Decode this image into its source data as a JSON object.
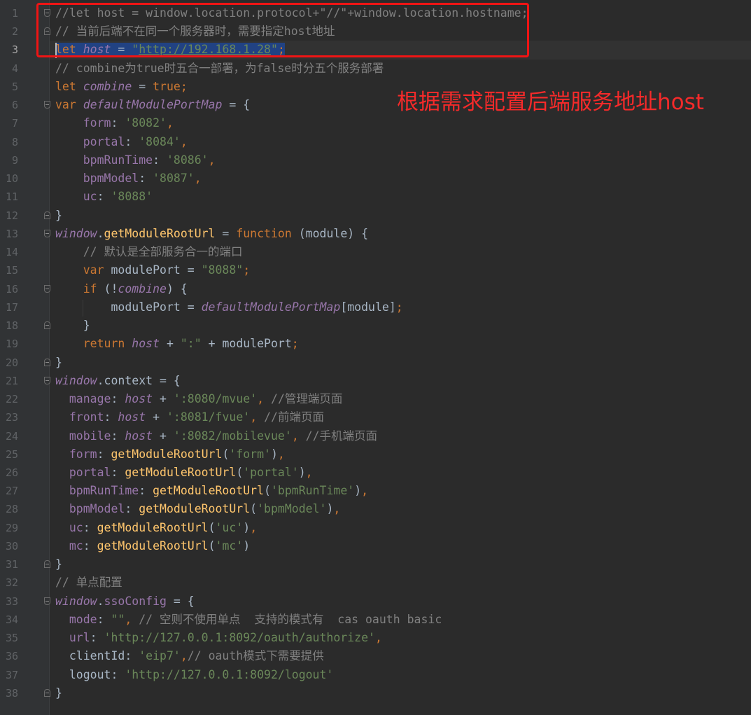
{
  "editor": {
    "current_line": 3,
    "colors": {
      "background": "#2b2b2b",
      "keyword": "#cc7832",
      "identifier": "#9876aa",
      "string": "#6a8759",
      "comment": "#808080",
      "function": "#ffc66d",
      "text": "#a9b7c6",
      "selection": "#214283"
    },
    "lines": [
      {
        "n": "1",
        "fold": "open",
        "tokens": [
          [
            "c",
            "//let host = window.location.protocol+\"//\"+window.location.hostname;"
          ]
        ]
      },
      {
        "n": "2",
        "fold": "close",
        "tokens": [
          [
            "c",
            "// 当前后端不在同一个服务器时，需要指定host地址"
          ]
        ]
      },
      {
        "n": "3",
        "selected": true,
        "tokens": [
          [
            "k",
            "let"
          ],
          [
            "t",
            " "
          ],
          [
            "v",
            "host"
          ],
          [
            "t",
            " = "
          ],
          [
            "s",
            "\""
          ],
          [
            "u",
            "http://192.168.1.28"
          ],
          [
            "s",
            "\""
          ],
          [
            "k",
            ";"
          ]
        ]
      },
      {
        "n": "4",
        "tokens": [
          [
            "c",
            "// combine为true时五合一部署，为false时分五个服务部署"
          ]
        ]
      },
      {
        "n": "5",
        "tokens": [
          [
            "k",
            "let "
          ],
          [
            "v",
            "combine"
          ],
          [
            "t",
            " = "
          ],
          [
            "k",
            "true;"
          ]
        ]
      },
      {
        "n": "6",
        "fold": "open",
        "tokens": [
          [
            "k",
            "var "
          ],
          [
            "v",
            "defaultModulePortMap"
          ],
          [
            "t",
            " = {"
          ]
        ]
      },
      {
        "n": "7",
        "tokens": [
          [
            "p",
            "    form"
          ],
          [
            "t",
            ": "
          ],
          [
            "s",
            "'8082'"
          ],
          [
            "k",
            ","
          ]
        ]
      },
      {
        "n": "8",
        "tokens": [
          [
            "p",
            "    portal"
          ],
          [
            "t",
            ": "
          ],
          [
            "s",
            "'8084'"
          ],
          [
            "k",
            ","
          ]
        ]
      },
      {
        "n": "9",
        "tokens": [
          [
            "p",
            "    bpmRunTime"
          ],
          [
            "t",
            ": "
          ],
          [
            "s",
            "'8086'"
          ],
          [
            "k",
            ","
          ]
        ]
      },
      {
        "n": "10",
        "tokens": [
          [
            "p",
            "    bpmModel"
          ],
          [
            "t",
            ": "
          ],
          [
            "s",
            "'8087'"
          ],
          [
            "k",
            ","
          ]
        ]
      },
      {
        "n": "11",
        "tokens": [
          [
            "p",
            "    uc"
          ],
          [
            "t",
            ": "
          ],
          [
            "s",
            "'8088'"
          ]
        ]
      },
      {
        "n": "12",
        "fold": "close",
        "tokens": [
          [
            "t",
            "}"
          ]
        ]
      },
      {
        "n": "13",
        "fold": "open",
        "tokens": [
          [
            "v",
            "window"
          ],
          [
            "t",
            "."
          ],
          [
            "f",
            "getModuleRootUrl"
          ],
          [
            "t",
            " = "
          ],
          [
            "k",
            "function"
          ],
          [
            "t",
            " (module) {"
          ]
        ]
      },
      {
        "n": "14",
        "tokens": [
          [
            "c",
            "    // 默认是全部服务合一的端口"
          ]
        ]
      },
      {
        "n": "15",
        "tokens": [
          [
            "k",
            "    var"
          ],
          [
            "t",
            " modulePort = "
          ],
          [
            "s",
            "\"8088\""
          ],
          [
            "k",
            ";"
          ]
        ]
      },
      {
        "n": "16",
        "fold": "open",
        "tokens": [
          [
            "k",
            "    if"
          ],
          [
            "t",
            " (!"
          ],
          [
            "v",
            "combine"
          ],
          [
            "t",
            ") {"
          ]
        ]
      },
      {
        "n": "17",
        "tokens": [
          [
            "t",
            "        modulePort = "
          ],
          [
            "v",
            "defaultModulePortMap"
          ],
          [
            "t",
            "[module]"
          ],
          [
            "k",
            ";"
          ]
        ]
      },
      {
        "n": "18",
        "fold": "close",
        "tokens": [
          [
            "t",
            "    }"
          ]
        ]
      },
      {
        "n": "19",
        "tokens": [
          [
            "k",
            "    return "
          ],
          [
            "v",
            "host"
          ],
          [
            "t",
            " + "
          ],
          [
            "s",
            "\":\""
          ],
          [
            "t",
            " + modulePort"
          ],
          [
            "k",
            ";"
          ]
        ]
      },
      {
        "n": "20",
        "fold": "close",
        "tokens": [
          [
            "t",
            "}"
          ]
        ]
      },
      {
        "n": "21",
        "fold": "open",
        "tokens": [
          [
            "v",
            "window"
          ],
          [
            "t",
            ".context = {"
          ]
        ]
      },
      {
        "n": "22",
        "tokens": [
          [
            "p",
            "  manage"
          ],
          [
            "t",
            ": "
          ],
          [
            "v",
            "host"
          ],
          [
            "t",
            " + "
          ],
          [
            "s",
            "':8080/mvue'"
          ],
          [
            "k",
            ","
          ],
          [
            "c",
            " //管理端页面"
          ]
        ]
      },
      {
        "n": "23",
        "tokens": [
          [
            "p",
            "  front"
          ],
          [
            "t",
            ": "
          ],
          [
            "v",
            "host"
          ],
          [
            "t",
            " + "
          ],
          [
            "s",
            "':8081/fvue'"
          ],
          [
            "k",
            ","
          ],
          [
            "c",
            " //前端页面"
          ]
        ]
      },
      {
        "n": "24",
        "tokens": [
          [
            "p",
            "  mobile"
          ],
          [
            "t",
            ": "
          ],
          [
            "v",
            "host"
          ],
          [
            "t",
            " + "
          ],
          [
            "s",
            "':8082/mobilevue'"
          ],
          [
            "k",
            ","
          ],
          [
            "c",
            " //手机端页面"
          ]
        ]
      },
      {
        "n": "25",
        "tokens": [
          [
            "p",
            "  form"
          ],
          [
            "t",
            ": "
          ],
          [
            "f",
            "getModuleRootUrl"
          ],
          [
            "t",
            "("
          ],
          [
            "s",
            "'form'"
          ],
          [
            "t",
            ")"
          ],
          [
            "k",
            ","
          ]
        ]
      },
      {
        "n": "26",
        "tokens": [
          [
            "p",
            "  portal"
          ],
          [
            "t",
            ": "
          ],
          [
            "f",
            "getModuleRootUrl"
          ],
          [
            "t",
            "("
          ],
          [
            "s",
            "'portal'"
          ],
          [
            "t",
            ")"
          ],
          [
            "k",
            ","
          ]
        ]
      },
      {
        "n": "27",
        "tokens": [
          [
            "p",
            "  bpmRunTime"
          ],
          [
            "t",
            ": "
          ],
          [
            "f",
            "getModuleRootUrl"
          ],
          [
            "t",
            "("
          ],
          [
            "s",
            "'bpmRunTime'"
          ],
          [
            "t",
            ")"
          ],
          [
            "k",
            ","
          ]
        ]
      },
      {
        "n": "28",
        "tokens": [
          [
            "p",
            "  bpmModel"
          ],
          [
            "t",
            ": "
          ],
          [
            "f",
            "getModuleRootUrl"
          ],
          [
            "t",
            "("
          ],
          [
            "s",
            "'bpmModel'"
          ],
          [
            "t",
            ")"
          ],
          [
            "k",
            ","
          ]
        ]
      },
      {
        "n": "29",
        "tokens": [
          [
            "p",
            "  uc"
          ],
          [
            "t",
            ": "
          ],
          [
            "f",
            "getModuleRootUrl"
          ],
          [
            "t",
            "("
          ],
          [
            "s",
            "'uc'"
          ],
          [
            "t",
            ")"
          ],
          [
            "k",
            ","
          ]
        ]
      },
      {
        "n": "30",
        "tokens": [
          [
            "p",
            "  mc"
          ],
          [
            "t",
            ": "
          ],
          [
            "f",
            "getModuleRootUrl"
          ],
          [
            "t",
            "("
          ],
          [
            "s",
            "'mc'"
          ],
          [
            "t",
            ")"
          ]
        ]
      },
      {
        "n": "31",
        "fold": "close",
        "tokens": [
          [
            "t",
            "}"
          ]
        ]
      },
      {
        "n": "32",
        "tokens": [
          [
            "c",
            "// 单点配置"
          ]
        ]
      },
      {
        "n": "33",
        "fold": "open",
        "tokens": [
          [
            "v",
            "window"
          ],
          [
            "t",
            "."
          ],
          [
            "p",
            "ssoConfig"
          ],
          [
            "t",
            " = {"
          ]
        ]
      },
      {
        "n": "34",
        "tokens": [
          [
            "p",
            "  mode"
          ],
          [
            "t",
            ": "
          ],
          [
            "s",
            "\"\""
          ],
          [
            "k",
            ","
          ],
          [
            "c",
            " // 空则不使用单点  支持的模式有  cas oauth basic"
          ]
        ]
      },
      {
        "n": "35",
        "tokens": [
          [
            "p",
            "  url"
          ],
          [
            "t",
            ": "
          ],
          [
            "s",
            "'http://127.0.0.1:8092/oauth/authorize'"
          ],
          [
            "k",
            ","
          ]
        ]
      },
      {
        "n": "36",
        "tokens": [
          [
            "t",
            "  clientId: "
          ],
          [
            "s",
            "'eip7'"
          ],
          [
            "k",
            ","
          ],
          [
            "c",
            "// oauth模式下需要提供"
          ]
        ]
      },
      {
        "n": "37",
        "tokens": [
          [
            "t",
            "  logout: "
          ],
          [
            "s",
            "'http://127.0.0.1:8092/logout'"
          ]
        ]
      },
      {
        "n": "38",
        "fold": "close",
        "tokens": [
          [
            "t",
            "}"
          ]
        ]
      }
    ]
  },
  "annotation": {
    "text": "根据需求配置后端服务地址host",
    "color": "#f01414"
  }
}
